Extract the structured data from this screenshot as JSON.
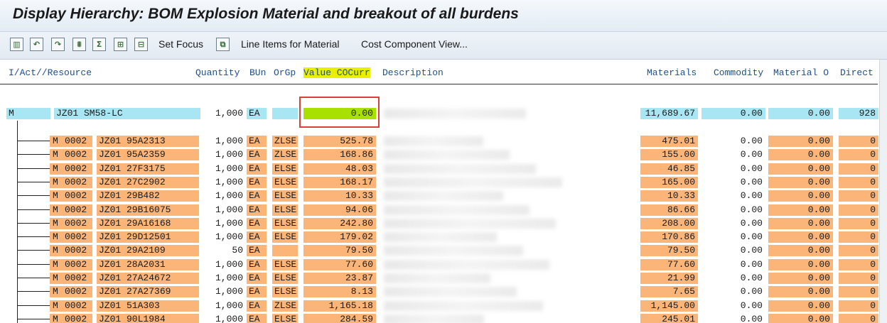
{
  "title": "Display Hierarchy: BOM Explosion Material and breakout of all burdens",
  "toolbar": {
    "set_focus": "Set Focus",
    "line_items": "Line Items for Material",
    "cost_component_view": "Cost Component View..."
  },
  "headers": {
    "resource": "I/Act//Resource",
    "quantity": "Quantity",
    "bun": "BUn",
    "orggp": "OrGp",
    "value": "Value COCurr",
    "description": "Description",
    "materials": "Materials",
    "commodity": "Commodity",
    "material_o": "Material O",
    "direct": "Direct"
  },
  "top_row": {
    "type": "M",
    "material": "JZ01 SM58-LC",
    "quantity": "1,000",
    "bun": "EA",
    "orggp": "",
    "value": "0.00",
    "materials": "11,689.67",
    "commodity": "0.00",
    "material_o": "0.00",
    "direct": "928"
  },
  "rows": [
    {
      "type": "M",
      "plant": "0002",
      "material": "JZ01 95A2313",
      "quantity": "1,000",
      "bun": "EA",
      "orggp": "ZLSE",
      "value": "525.78",
      "materials": "475.01",
      "commodity": "0.00",
      "material_o": "0.00",
      "direct": "0"
    },
    {
      "type": "M",
      "plant": "0002",
      "material": "JZ01 95A2359",
      "quantity": "1,000",
      "bun": "EA",
      "orggp": "ZLSE",
      "value": "168.86",
      "materials": "155.00",
      "commodity": "0.00",
      "material_o": "0.00",
      "direct": "0"
    },
    {
      "type": "M",
      "plant": "0002",
      "material": "JZ01 27F3175",
      "quantity": "1,000",
      "bun": "EA",
      "orggp": "ELSE",
      "value": "48.03",
      "materials": "46.85",
      "commodity": "0.00",
      "material_o": "0.00",
      "direct": "0"
    },
    {
      "type": "M",
      "plant": "0002",
      "material": "JZ01 27C2902",
      "quantity": "1,000",
      "bun": "EA",
      "orggp": "ELSE",
      "value": "168.17",
      "materials": "165.00",
      "commodity": "0.00",
      "material_o": "0.00",
      "direct": "0"
    },
    {
      "type": "M",
      "plant": "0002",
      "material": "JZ01 29B482",
      "quantity": "1,000",
      "bun": "EA",
      "orggp": "ELSE",
      "value": "10.33",
      "materials": "10.33",
      "commodity": "0.00",
      "material_o": "0.00",
      "direct": "0"
    },
    {
      "type": "M",
      "plant": "0002",
      "material": "JZ01 29B16075",
      "quantity": "1,000",
      "bun": "EA",
      "orggp": "ELSE",
      "value": "94.06",
      "materials": "86.66",
      "commodity": "0.00",
      "material_o": "0.00",
      "direct": "0"
    },
    {
      "type": "M",
      "plant": "0002",
      "material": "JZ01 29A16168",
      "quantity": "1,000",
      "bun": "EA",
      "orggp": "ELSE",
      "value": "242.80",
      "materials": "208.00",
      "commodity": "0.00",
      "material_o": "0.00",
      "direct": "0"
    },
    {
      "type": "M",
      "plant": "0002",
      "material": "JZ01 29D12501",
      "quantity": "1,000",
      "bun": "EA",
      "orggp": "ELSE",
      "value": "179.02",
      "materials": "170.86",
      "commodity": "0.00",
      "material_o": "0.00",
      "direct": "0"
    },
    {
      "type": "M",
      "plant": "0002",
      "material": "JZ01 29A2109",
      "quantity": "50",
      "bun": "EA",
      "orggp": "",
      "value": "79.50",
      "materials": "79.50",
      "commodity": "0.00",
      "material_o": "0.00",
      "direct": "0"
    },
    {
      "type": "M",
      "plant": "0002",
      "material": "JZ01 28A2031",
      "quantity": "1,000",
      "bun": "EA",
      "orggp": "ELSE",
      "value": "77.60",
      "materials": "77.60",
      "commodity": "0.00",
      "material_o": "0.00",
      "direct": "0"
    },
    {
      "type": "M",
      "plant": "0002",
      "material": "JZ01 27A24672",
      "quantity": "1,000",
      "bun": "EA",
      "orggp": "ELSE",
      "value": "23.87",
      "materials": "21.99",
      "commodity": "0.00",
      "material_o": "0.00",
      "direct": "0"
    },
    {
      "type": "M",
      "plant": "0002",
      "material": "JZ01 27A27369",
      "quantity": "1,000",
      "bun": "EA",
      "orggp": "ELSE",
      "value": "8.13",
      "materials": "7.65",
      "commodity": "0.00",
      "material_o": "0.00",
      "direct": "0"
    },
    {
      "type": "M",
      "plant": "0002",
      "material": "JZ01 51A303",
      "quantity": "1,000",
      "bun": "EA",
      "orggp": "ZLSE",
      "value": "1,165.18",
      "materials": "1,145.00",
      "commodity": "0.00",
      "material_o": "0.00",
      "direct": "0"
    },
    {
      "type": "M",
      "plant": "0002",
      "material": "JZ01 90L1984",
      "quantity": "1,000",
      "bun": "EA",
      "orggp": "ELSE",
      "value": "284.59",
      "materials": "245.01",
      "commodity": "0.00",
      "material_o": "0.00",
      "direct": "0"
    }
  ],
  "colors": {
    "top_row": "#a9e6f4",
    "child_rows": "#fbb579",
    "highlight": "#a8e000",
    "highlight_header": "#e8f000",
    "selection_box": "#d9403a"
  }
}
